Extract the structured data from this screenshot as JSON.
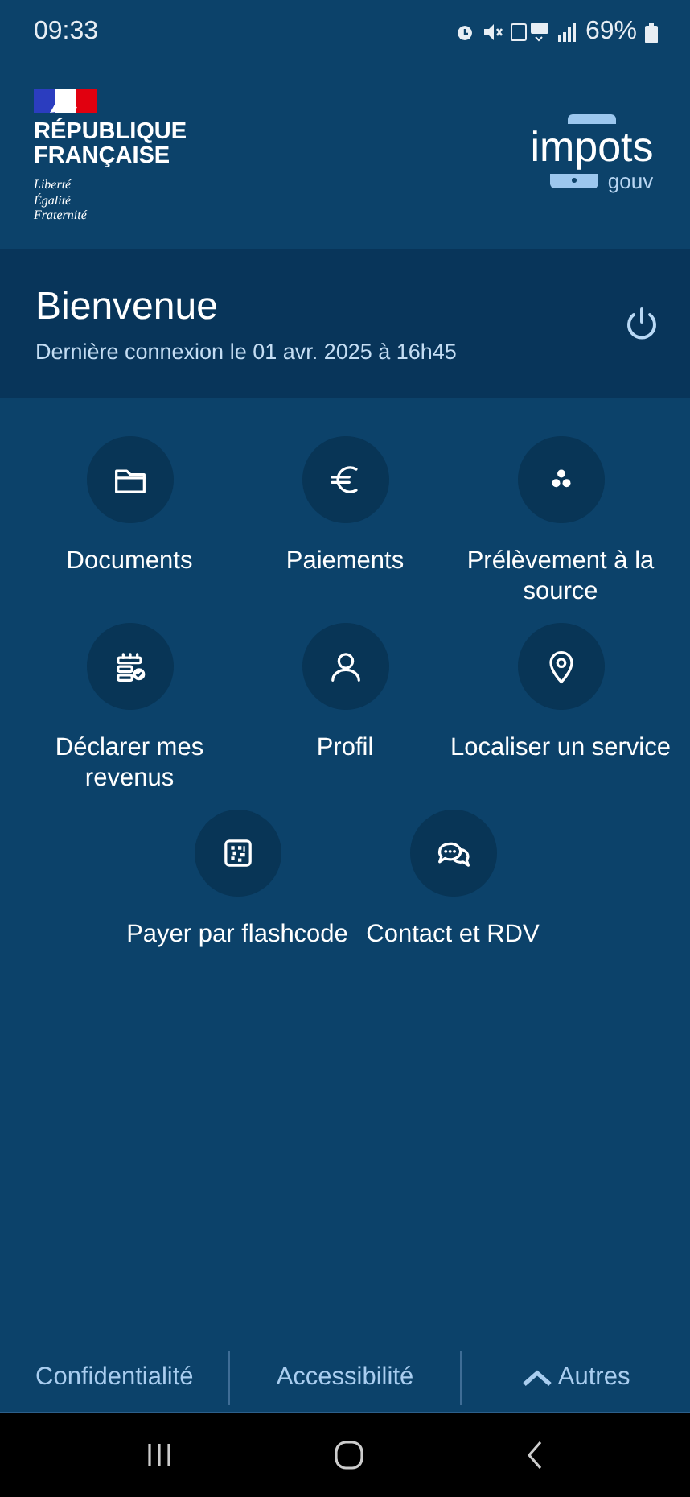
{
  "status_bar": {
    "time": "09:33",
    "battery": "69%"
  },
  "header": {
    "republic": [
      "RÉPUBLIQUE",
      "FRANÇAISE"
    ],
    "motto": [
      "Liberté",
      "Égalité",
      "Fraternité"
    ],
    "brand": "impots",
    "brand_suffix": "gouv"
  },
  "welcome": {
    "title": "Bienvenue",
    "last_login": "Dernière connexion le 01 avr. 2025 à 16h45"
  },
  "tiles": [
    {
      "kind": "folder",
      "label": "Documents"
    },
    {
      "kind": "euro",
      "label": "Paiements"
    },
    {
      "kind": "dots",
      "label": "Prélèvement à la source"
    },
    {
      "kind": "declare",
      "label": "Déclarer mes revenus"
    },
    {
      "kind": "person",
      "label": "Profil"
    },
    {
      "kind": "pin",
      "label": "Localiser un service"
    },
    {
      "kind": "qr",
      "label": "Payer par flashcode"
    },
    {
      "kind": "chat",
      "label": "Contact et RDV"
    }
  ],
  "footer": {
    "links": [
      "Confidentialité",
      "Accessibilité"
    ],
    "more": "Autres"
  }
}
